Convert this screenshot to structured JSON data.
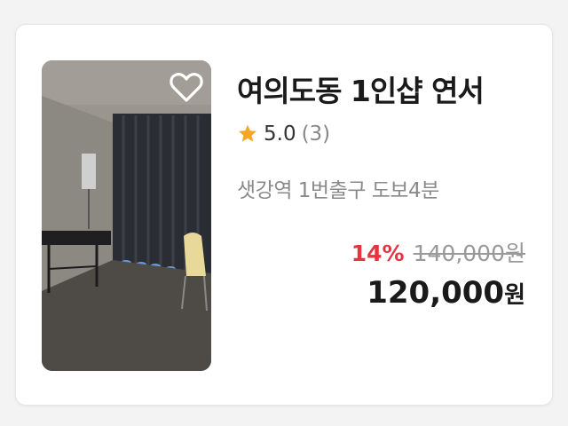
{
  "listing": {
    "title": "여의도동 1인샵 연서",
    "rating": "5.0",
    "review_count": "(3)",
    "location": "샛강역 1번출구 도보4분",
    "discount": "14%",
    "original_price": "140,000원",
    "final_price_number": "120,000",
    "final_price_unit": "원",
    "favorite_icon": "heart-outline-icon",
    "rating_icon": "star-icon",
    "colors": {
      "star": "#f5a623",
      "discount": "#e6333f",
      "title": "#1a1a1a"
    }
  }
}
